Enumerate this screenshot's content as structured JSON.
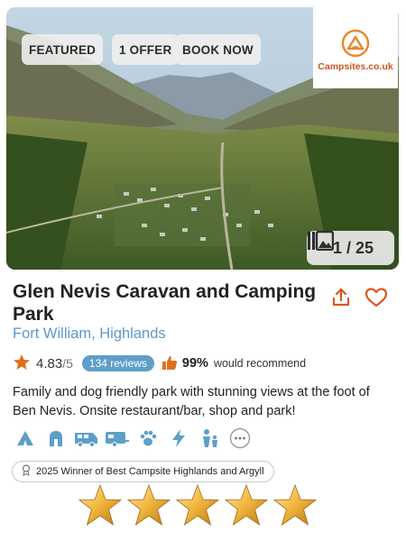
{
  "badges": {
    "featured": "FEATURED",
    "offer": "1 OFFER",
    "book": "BOOK NOW"
  },
  "logo": {
    "brand": "Campsites.co.uk"
  },
  "gallery": {
    "counter": "1 / 25",
    "icon": "gallery-icon"
  },
  "park": {
    "title": "Glen Nevis Caravan and Camping Park",
    "location": "Fort William, Highlands"
  },
  "rating": {
    "score": "4.83",
    "out_of": "/5",
    "reviews": "134 reviews",
    "recommend_pct": "99%",
    "recommend_text": "would recommend"
  },
  "description": "Family and dog friendly park with stunning views at the foot of Ben Nevis. Onsite restaurant/bar, shop and park!",
  "amenities": [
    "tent-icon",
    "cabin-icon",
    "motorhome-icon",
    "caravan-icon",
    "paw-icon",
    "electric-icon",
    "family-icon",
    "more-icon"
  ],
  "award": "2025 Winner of Best Campsite Highlands and Argyll",
  "award_stars": 5,
  "colors": {
    "accent_blue": "#5e9fc7",
    "star_orange": "#e0701c",
    "brand_orange": "#e8872c"
  }
}
